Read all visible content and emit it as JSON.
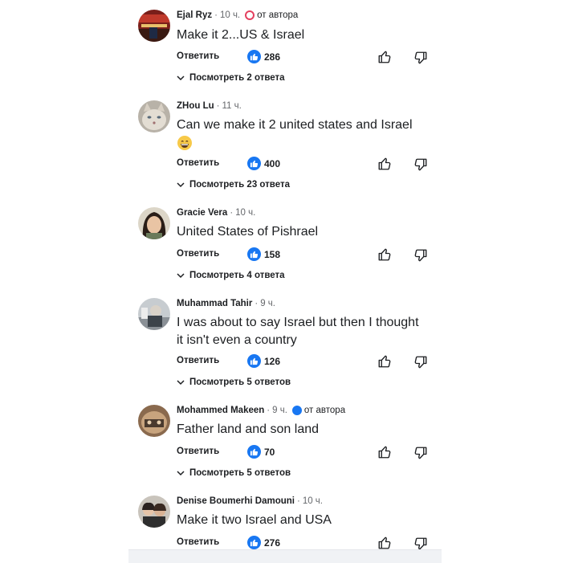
{
  "comments": [
    {
      "author": "Ejal Ryz",
      "time": "10 ч.",
      "author_badge": "от автора",
      "text": "Make it 2...US & Israel",
      "reply_label": "Ответить",
      "likes": "286",
      "view_replies": "Посмотреть 2 ответа"
    },
    {
      "author": "ZHou Lu",
      "time": "11 ч.",
      "text": "Can we make it 2 united states and Israel",
      "reply_label": "Ответить",
      "likes": "400",
      "view_replies": "Посмотреть 23 ответа"
    },
    {
      "author": "Gracie Vera",
      "time": "10 ч.",
      "text": "United States of Pishrael",
      "reply_label": "Ответить",
      "likes": "158",
      "view_replies": "Посмотреть 4 ответа"
    },
    {
      "author": "Muhammad Tahir",
      "time": "9 ч.",
      "text_line1": "I was about to say Israel but then I thought",
      "text_line2": "it isn't even a country",
      "reply_label": "Ответить",
      "likes": "126",
      "view_replies": "Посмотреть 5 ответов"
    },
    {
      "author": "Mohammed Makeen",
      "time": "9 ч.",
      "author_badge": "от автора",
      "text": "Father land and son land",
      "reply_label": "Ответить",
      "likes": "70",
      "view_replies": "Посмотреть 5 ответов"
    },
    {
      "author": "Denise Boumerhi Damouni",
      "time": "10 ч.",
      "text": "Make it two Israel and USA",
      "reply_label": "Ответить",
      "likes": "276"
    }
  ],
  "colors": {
    "like_blue": "#1877f2",
    "author_badge_pink": "#e4405f",
    "author_badge_blue": "#1877f2",
    "secondary_text": "#65676b"
  },
  "icons": [
    "like-reaction-icon",
    "thumbs-up-icon",
    "thumbs-down-icon",
    "chevron-down-icon",
    "author-badge-icon",
    "grinning-emoji-icon"
  ]
}
